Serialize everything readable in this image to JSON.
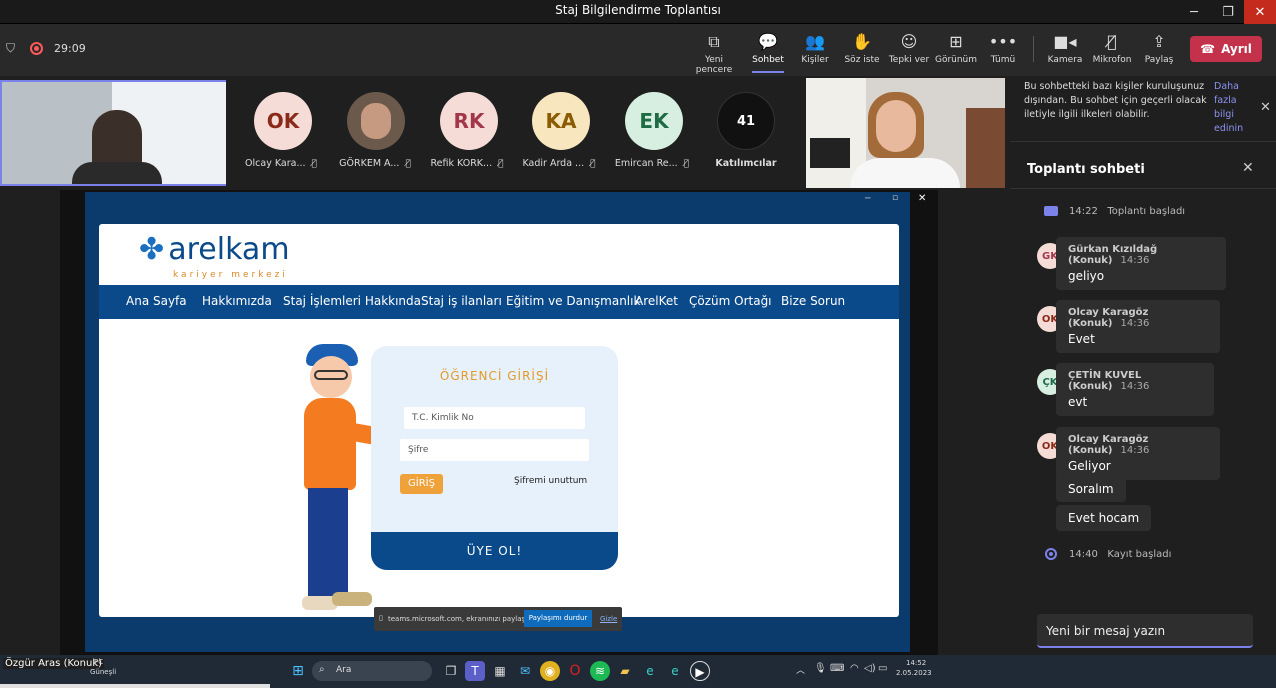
{
  "window": {
    "title": "Staj Bilgilendirme Toplantısı"
  },
  "toolbar": {
    "timer": "29:09",
    "items": [
      {
        "label": "Yeni pencere",
        "icon": "pop-out-icon"
      },
      {
        "label": "Sohbet",
        "icon": "chat-icon"
      },
      {
        "label": "Kişiler",
        "icon": "people-icon"
      },
      {
        "label": "Söz iste",
        "icon": "raise-hand-icon"
      },
      {
        "label": "Tepki ver",
        "icon": "reaction-icon"
      },
      {
        "label": "Görünüm",
        "icon": "view-icon"
      },
      {
        "label": "Tümü",
        "icon": "more-icon"
      },
      {
        "label": "Kamera",
        "icon": "camera-icon"
      },
      {
        "label": "Mikrofon",
        "icon": "mic-off-icon"
      },
      {
        "label": "Paylaş",
        "icon": "share-icon"
      }
    ],
    "leave_label": "Ayrıl"
  },
  "participants": [
    {
      "initials": "OK",
      "name": "Olcay Kara...",
      "bg": "#f6dcd7",
      "fg": "#8a2b1a"
    },
    {
      "initials": "",
      "name": "GÖRKEM A...",
      "bg": "#6b5a4b",
      "fg": "#fff"
    },
    {
      "initials": "RK",
      "name": "Refik KORK...",
      "bg": "#f6dcd7",
      "fg": "#a2374a"
    },
    {
      "initials": "KA",
      "name": "Kadir Arda ...",
      "bg": "#f8e6bf",
      "fg": "#8a5b00"
    },
    {
      "initials": "EK",
      "name": "Emircan Re...",
      "bg": "#d6efe1",
      "fg": "#1e6b46"
    },
    {
      "initials": "41",
      "name": "Katılımcılar",
      "bg": "#111",
      "fg": "#fff"
    }
  ],
  "notice": {
    "text": "Bu sohbetteki bazı kişiler kuruluşunuz dışından. Bu sohbet için geçerli olacak iletiyle ilgili ilkeleri olabilir.",
    "link": "Daha fazla bilgi edinin"
  },
  "site": {
    "logo": "arelkam",
    "logo_sub": "kariyer merkezi",
    "nav": [
      "Ana Sayfa",
      "Hakkımızda",
      "Staj İşlemleri Hakkında",
      "Staj iş ilanları",
      "Eğitim ve Danışmanlık",
      "ArelKet",
      "Çözüm Ortağı",
      "Bize Sorun"
    ],
    "login_title": "ÖĞRENCİ GİRİŞİ",
    "tc_placeholder": "T.C. Kimlik No",
    "password_placeholder": "Şifre",
    "login_btn": "GİRİŞ",
    "forgot": "Şifremi unuttum",
    "register": "ÜYE OL!"
  },
  "share_bar": {
    "text": "teams.microsoft.com, ekranınızı paylaşıyor.",
    "stop": "Paylaşımı durdur",
    "hide": "Gizle"
  },
  "chat": {
    "title": "Toplantı sohbeti",
    "started": {
      "time": "14:22",
      "text": "Toplantı başladı"
    },
    "messages": [
      {
        "initials": "GK",
        "author": "Gürkan Kızıldağ (Konuk)",
        "time": "14:36",
        "text": "geliyo",
        "bg": "#f6dcd7",
        "fg": "#a2374a"
      },
      {
        "initials": "OK",
        "author": "Olcay Karagöz (Konuk)",
        "time": "14:36",
        "text": "Evet",
        "bg": "#f6dcd7",
        "fg": "#8a2b1a"
      },
      {
        "initials": "ÇK",
        "author": "ÇETİN KUVEL (Konuk)",
        "time": "14:36",
        "text": "evt",
        "bg": "#d6efe1",
        "fg": "#1e6b46"
      },
      {
        "initials": "OK",
        "author": "Olcay Karagöz (Konuk)",
        "time": "14:36",
        "text": "Geliyor",
        "bg": "#f6dcd7",
        "fg": "#8a2b1a"
      }
    ],
    "followups": [
      "Soralım",
      "Evet hocam"
    ],
    "recording": {
      "time": "14:40",
      "text": "Kayıt başladı"
    },
    "input_placeholder": "Yeni bir mesaj yazın"
  },
  "self_view": {
    "name": "Özgür Aras (Konuk)"
  },
  "taskbar": {
    "search": "Ara",
    "pc": "PC",
    "weather": "Güneşli",
    "time": "14:52",
    "date": "2.05.2023"
  }
}
